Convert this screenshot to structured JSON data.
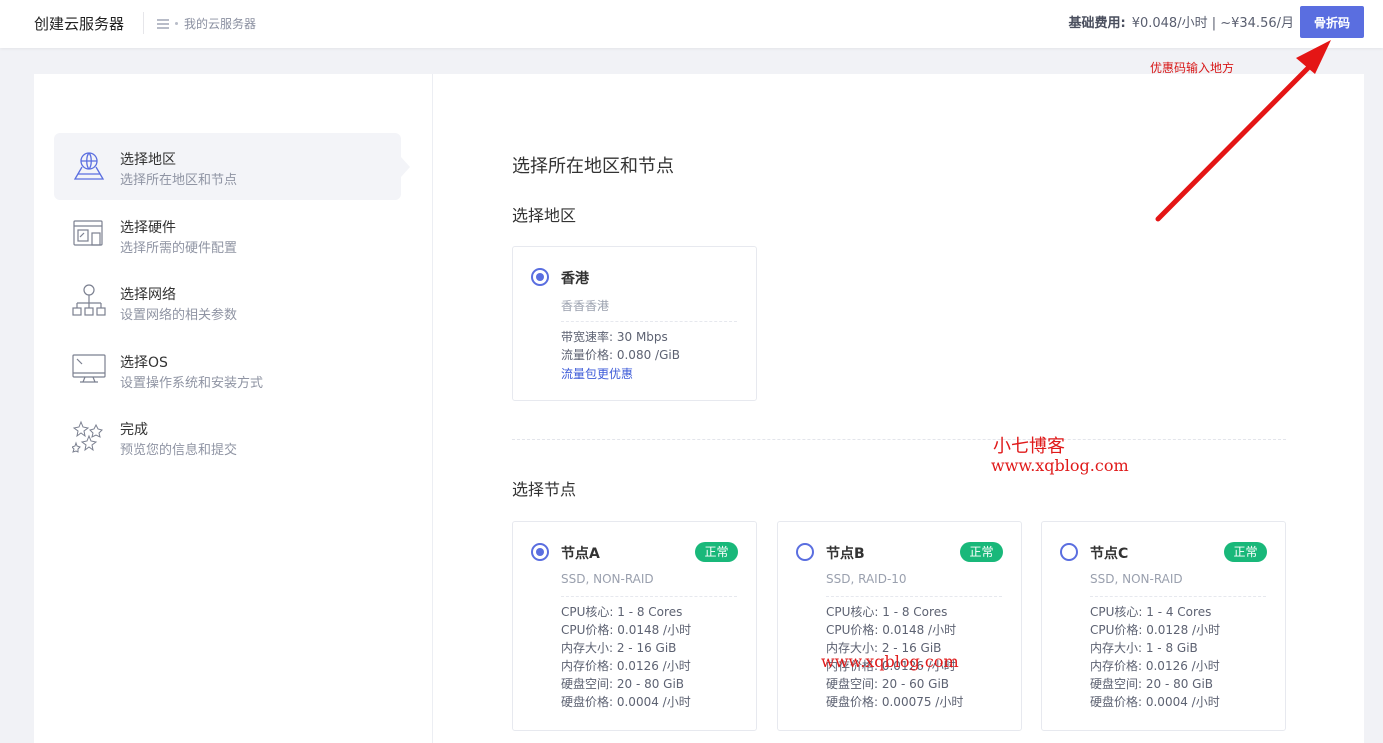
{
  "header": {
    "title": "创建云服务器",
    "breadcrumb": "我的云服务器",
    "fee_label": "基础费用:",
    "fee_value": "¥0.048/小时 | ~¥34.56/月",
    "coupon_button": "骨折码"
  },
  "annotation": {
    "text": "优惠码输入地方",
    "color": "#d81818"
  },
  "sidebar": {
    "steps": [
      {
        "title": "选择地区",
        "desc": "选择所在地区和节点",
        "icon": "globe-map-icon",
        "active": true
      },
      {
        "title": "选择硬件",
        "desc": "选择所需的硬件配置",
        "icon": "hardware-icon",
        "active": false
      },
      {
        "title": "选择网络",
        "desc": "设置网络的相关参数",
        "icon": "network-icon",
        "active": false
      },
      {
        "title": "选择OS",
        "desc": "设置操作系统和安装方式",
        "icon": "monitor-icon",
        "active": false
      },
      {
        "title": "完成",
        "desc": "预览您的信息和提交",
        "icon": "stars-icon",
        "active": false
      }
    ]
  },
  "main": {
    "heading": "选择所在地区和节点",
    "region_heading": "选择地区",
    "region": {
      "name": "香港",
      "sub": "香香香港",
      "specs": [
        "带宽速率: 30 Mbps",
        "流量价格: 0.080 /GiB"
      ],
      "link": "流量包更优惠",
      "selected": true
    },
    "node_heading": "选择节点",
    "nodes": [
      {
        "name": "节点A",
        "status": "正常",
        "sub": "SSD, NON-RAID",
        "selected": true,
        "specs": [
          "CPU核心: 1 - 8 Cores",
          "CPU价格: 0.0148 /小时",
          "内存大小: 2 - 16 GiB",
          "内存价格: 0.0126 /小时",
          "硬盘空间: 20 - 80 GiB",
          "硬盘价格: 0.0004 /小时"
        ]
      },
      {
        "name": "节点B",
        "status": "正常",
        "sub": "SSD, RAID-10",
        "selected": false,
        "specs": [
          "CPU核心: 1 - 8 Cores",
          "CPU价格: 0.0148 /小时",
          "内存大小: 2 - 16 GiB",
          "内存价格: 0.0126 /小时",
          "硬盘空间: 20 - 60 GiB",
          "硬盘价格: 0.00075 /小时"
        ]
      },
      {
        "name": "节点C",
        "status": "正常",
        "sub": "SSD, NON-RAID",
        "selected": false,
        "specs": [
          "CPU核心: 1 - 4 Cores",
          "CPU价格: 0.0128 /小时",
          "内存大小: 1 - 8 GiB",
          "内存价格: 0.0126 /小时",
          "硬盘空间: 20 - 80 GiB",
          "硬盘价格: 0.0004 /小时"
        ]
      }
    ]
  },
  "watermarks": {
    "name": "小七博客",
    "url": "www.xqblog.com"
  },
  "colors": {
    "accent": "#5a6ee0",
    "status_ok": "#19b87a",
    "link": "#3d5bd8",
    "annotation": "#d81818"
  }
}
